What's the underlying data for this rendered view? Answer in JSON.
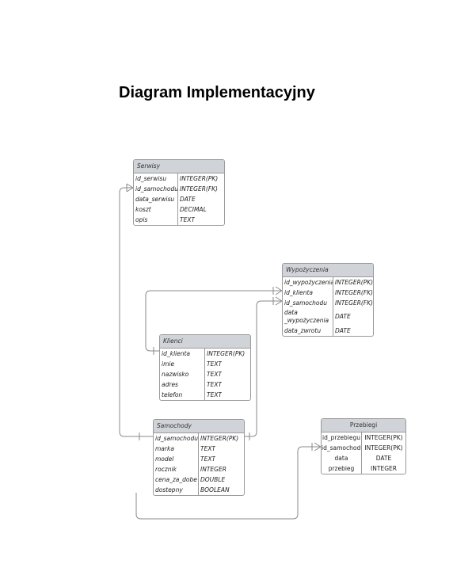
{
  "title": "Diagram Implementacyjny",
  "entities": {
    "serwisy": {
      "name": "Serwisy",
      "rows": [
        {
          "col": "id_serwisu",
          "type": "INTEGER(PK)"
        },
        {
          "col": "id_samochodu",
          "type": "INTEGER(FK)"
        },
        {
          "col": "data_serwisu",
          "type": "DATE"
        },
        {
          "col": "koszt",
          "type": "DECIMAL"
        },
        {
          "col": "opis",
          "type": "TEXT"
        }
      ]
    },
    "wypozyczenia": {
      "name": "Wypożyczenia",
      "rows": [
        {
          "col": "id_wypożyczenia",
          "type": "INTEGER(PK)"
        },
        {
          "col": "id_klienta",
          "type": "INTEGER(FK)"
        },
        {
          "col": "id_samochodu",
          "type": "INTEGER(FK)"
        },
        {
          "col": "data _wypożyczenia",
          "type": "DATE"
        },
        {
          "col": "data_zwrotu",
          "type": "DATE"
        }
      ]
    },
    "klienci": {
      "name": "Klienci",
      "rows": [
        {
          "col": "id_klienta",
          "type": "INTEGER(PK)"
        },
        {
          "col": "imie",
          "type": "TEXT"
        },
        {
          "col": "nazwisko",
          "type": "TEXT"
        },
        {
          "col": "adres",
          "type": "TEXT"
        },
        {
          "col": "telefon",
          "type": "TEXT"
        }
      ]
    },
    "samochody": {
      "name": "Samochody",
      "rows": [
        {
          "col": "id_samochodu",
          "type": "INTEGER(PK)"
        },
        {
          "col": "marka",
          "type": "TEXT"
        },
        {
          "col": "model",
          "type": "TEXT"
        },
        {
          "col": "rocznik",
          "type": "INTEGER"
        },
        {
          "col": "cena_za_dobe",
          "type": "DOUBLE"
        },
        {
          "col": "dostepny",
          "type": "BOOLEAN"
        }
      ]
    },
    "przebiegi": {
      "name": "Przebiegi",
      "rows": [
        {
          "col": "id_przebiegu",
          "type": "INTEGER(PK)"
        },
        {
          "col": "id_samochodu",
          "type": "INTEGER(PK)"
        },
        {
          "col": "data",
          "type": "DATE"
        },
        {
          "col": "przebieg",
          "type": "INTEGER"
        }
      ]
    }
  }
}
